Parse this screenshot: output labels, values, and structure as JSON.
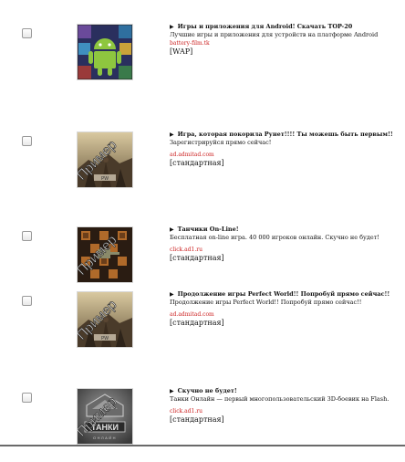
{
  "ads": [
    {
      "title": "Игры и приложения для Android! Скачать TOP-20",
      "description": "Лучшие игры и приложения для устройств на платформе Android",
      "domain": "battery-film.tk",
      "tag": "[WAP]",
      "image": "android-apps-image"
    },
    {
      "title": "Игра, которая покорила Рунет!!!! Ты можешь быть первым!!",
      "description": "Зарегистрируйся прямо сейчас!",
      "domain": "ad.admitad.com",
      "tag": "[стандартная]",
      "image": "warriors-game-image",
      "watermark": "Пример"
    },
    {
      "title": "Танчики On-Line!",
      "description": "Бесплатная on-line игра. 40 000 игроков онлайн. Скучно не будет!",
      "domain": "click.ad1.ru",
      "tag": "[стандартная]",
      "image": "tank-game-image",
      "watermark": "Пример"
    },
    {
      "title": "Продолжение игры Perfect World!! Попробуй прямо сейчас!!",
      "description": "Продолжение игры Perfect World!! Попробуй прямо сейчас!!",
      "domain": "ad.admitad.com",
      "tag": "[стандартная]",
      "image": "warriors-game-image",
      "watermark": "Пример"
    },
    {
      "title": "Скучно не будет!",
      "description": "Танки Онлайн — первый многопользовательский 3D-боевик на Flash.",
      "domain": "click.ad1.ru",
      "tag": "[стандартная]",
      "image": "tanki-online-logo-image",
      "watermark": "Пример"
    }
  ]
}
